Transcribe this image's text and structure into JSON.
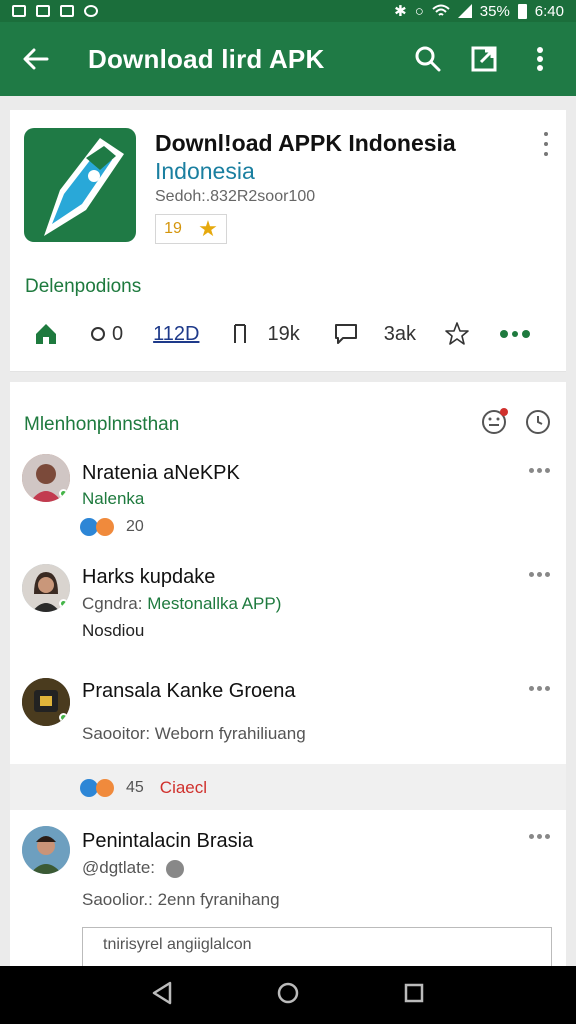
{
  "status_bar": {
    "battery": "35%",
    "time": "6:40",
    "left_icons": [
      "image-icon",
      "photo-icon",
      "camera-icon",
      "vpn-icon"
    ],
    "right_icons": [
      "bluetooth-icon",
      "alarm-icon",
      "wifi-icon",
      "signal-icon",
      "battery-icon"
    ]
  },
  "app_bar": {
    "title": "Download lird APK",
    "back_icon": "arrow-left-icon",
    "actions": [
      "search-icon",
      "open-external-icon",
      "more-vert-icon"
    ]
  },
  "app_card": {
    "name": "Downl!oad APPK Indonesia",
    "subtitle": "Indonesia",
    "meta": "Sedoh:.832R2soor100",
    "rating": "19",
    "section_label": "Delenpodions",
    "actions": [
      {
        "icon": "home-icon",
        "label": ""
      },
      {
        "icon": "eye-icon",
        "label": "0"
      },
      {
        "icon": "",
        "label": "112D"
      },
      {
        "icon": "bookmark-icon",
        "label": ""
      },
      {
        "icon": "",
        "label": "19k"
      },
      {
        "icon": "comment-icon",
        "label": ""
      },
      {
        "icon": "",
        "label": "3ak"
      },
      {
        "icon": "star-icon",
        "label": ""
      },
      {
        "icon": "more-horiz-icon",
        "label": ""
      }
    ]
  },
  "feed": {
    "title": "Mlenhonplnnsthan",
    "items": [
      {
        "name": "Nratenia aNeKPK",
        "line1": "Nalenka",
        "reaction_count": "20"
      },
      {
        "name": "Harks kupdake",
        "line1_prefix": "Cgndra:",
        "line1_highlight": "Mestonallka APP)",
        "line2": "Nosdiou"
      },
      {
        "name": "Pransala Kanke Groena",
        "line1": "Saooitor: Weborn fyrahiliuang",
        "reaction_count": "45",
        "reaction_label": "Ciaecl"
      },
      {
        "name": "Penintalacin Brasia",
        "line1": "@dgtlate:",
        "line2": "Saoolior.: 2enn fyranihang",
        "preview": "tnirisyrel angiiglalcon"
      }
    ]
  },
  "colors": {
    "app_bar": "#1f7a45",
    "status_bar": "#1b6e3b",
    "accent_green": "#1e7a3e",
    "accent_blue": "#1a7fa0",
    "rating_gold": "#d4950c",
    "reaction_red": "#d0312d"
  }
}
